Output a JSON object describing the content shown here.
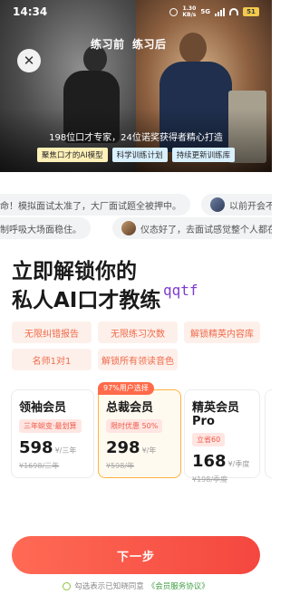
{
  "status_bar": {
    "time": "14:34",
    "speed_value": "1.30",
    "speed_unit": "KB/s",
    "network": "5G",
    "battery": "51"
  },
  "hero": {
    "before_label": "练习前",
    "after_label": "练习后",
    "subtitle": "198位口才专家，24位诺奖获得者精心打造",
    "tags": [
      "聚焦口才的AI模型",
      "科学训练计划",
      "持续更新训练库"
    ]
  },
  "testimonials": {
    "row1": [
      "救命！模拟面试太准了，大厂面试题全被押中。",
      "以前开会不敢"
    ],
    "row2": [
      "控制呼吸大场面稳住。",
      "仪态好了，去面试感觉整个人都在发光"
    ]
  },
  "headline": {
    "line1": "立即解锁你的",
    "line2": "私人AI口才教练",
    "handwritten": "qqtf"
  },
  "benefits": [
    "无限纠错报告",
    "无限练习次数",
    "解锁精英内容库",
    "名师1对1",
    "解锁所有领读音色"
  ],
  "plans": {
    "badge": "97%用户选择",
    "items": [
      {
        "name": "领袖会员",
        "tag": "三年蜕变·最划算",
        "price": "598",
        "period": "¥/三年",
        "original": "¥1698/三年"
      },
      {
        "name": "总裁会员",
        "tag": "限时优惠 50%",
        "price": "298",
        "period": "¥/年",
        "original": "¥598/年"
      },
      {
        "name": "精英会员Pro",
        "tag": "立省60",
        "price": "168",
        "period": "¥/季度",
        "original": "¥198/季度"
      }
    ]
  },
  "cta": {
    "next_label": "下一步"
  },
  "agreement": {
    "prefix": "勾选表示已知晓同意",
    "link": "《会员服务协议》"
  },
  "colors": {
    "accent": "#f4473f",
    "benefit_text": "#f06a4b",
    "selected_border": "#ffb23f",
    "agree_link": "#43a047"
  }
}
